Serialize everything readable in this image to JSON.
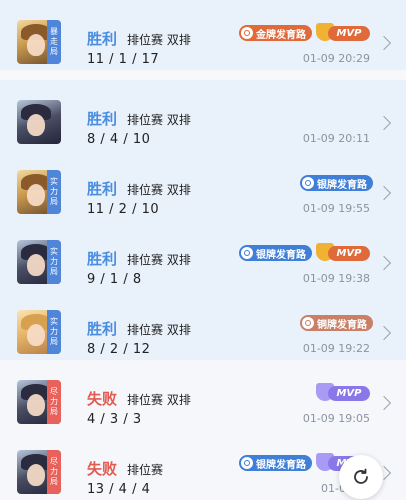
{
  "matches": [
    {
      "result": "胜利",
      "mode": "排位赛 双排",
      "kda": "11 / 1 / 17",
      "time": "01-09 20:29",
      "badge": "金牌发育路",
      "mvp": "MVP",
      "tag": [
        "暴",
        "走",
        "局"
      ]
    },
    {
      "result": "胜利",
      "mode": "排位赛 双排",
      "kda": "8 / 4 / 10",
      "time": "01-09 20:11"
    },
    {
      "result": "胜利",
      "mode": "排位赛 双排",
      "kda": "11 / 2 / 10",
      "time": "01-09 19:55",
      "badge": "银牌发育路",
      "tag": [
        "实",
        "力",
        "局"
      ]
    },
    {
      "result": "胜利",
      "mode": "排位赛 双排",
      "kda": "9 / 1 / 8",
      "time": "01-09 19:38",
      "badge": "银牌发育路",
      "mvp": "MVP",
      "tag": [
        "实",
        "力",
        "局"
      ]
    },
    {
      "result": "胜利",
      "mode": "排位赛 双排",
      "kda": "8 / 2 / 12",
      "time": "01-09 19:22",
      "badge": "铜牌发育路",
      "tag": [
        "实",
        "力",
        "局"
      ]
    },
    {
      "result": "失败",
      "mode": "排位赛 双排",
      "kda": "4 / 3 / 3",
      "time": "01-09 19:05",
      "mvp": "MVP",
      "tag": [
        "尽",
        "力",
        "局"
      ]
    },
    {
      "result": "失败",
      "mode": "排位赛",
      "kda": "13 / 4 / 4",
      "time": "01-0",
      "badge": "银牌发育路",
      "mvp": "MVP",
      "tag": [
        "尽",
        "力",
        "局"
      ]
    }
  ],
  "colors": {
    "win": "#4a8ee0",
    "loss": "#e35a50",
    "gold_badge": "#e06a3a",
    "silver_badge": "#3f7fd8",
    "bronze_badge": "#c98066",
    "mvp_gold": "#e06a3a",
    "mvp_purple": "#8a78e8"
  },
  "icons": {
    "row_arrow": "chevron-right-icon",
    "refresh": "refresh-icon"
  }
}
